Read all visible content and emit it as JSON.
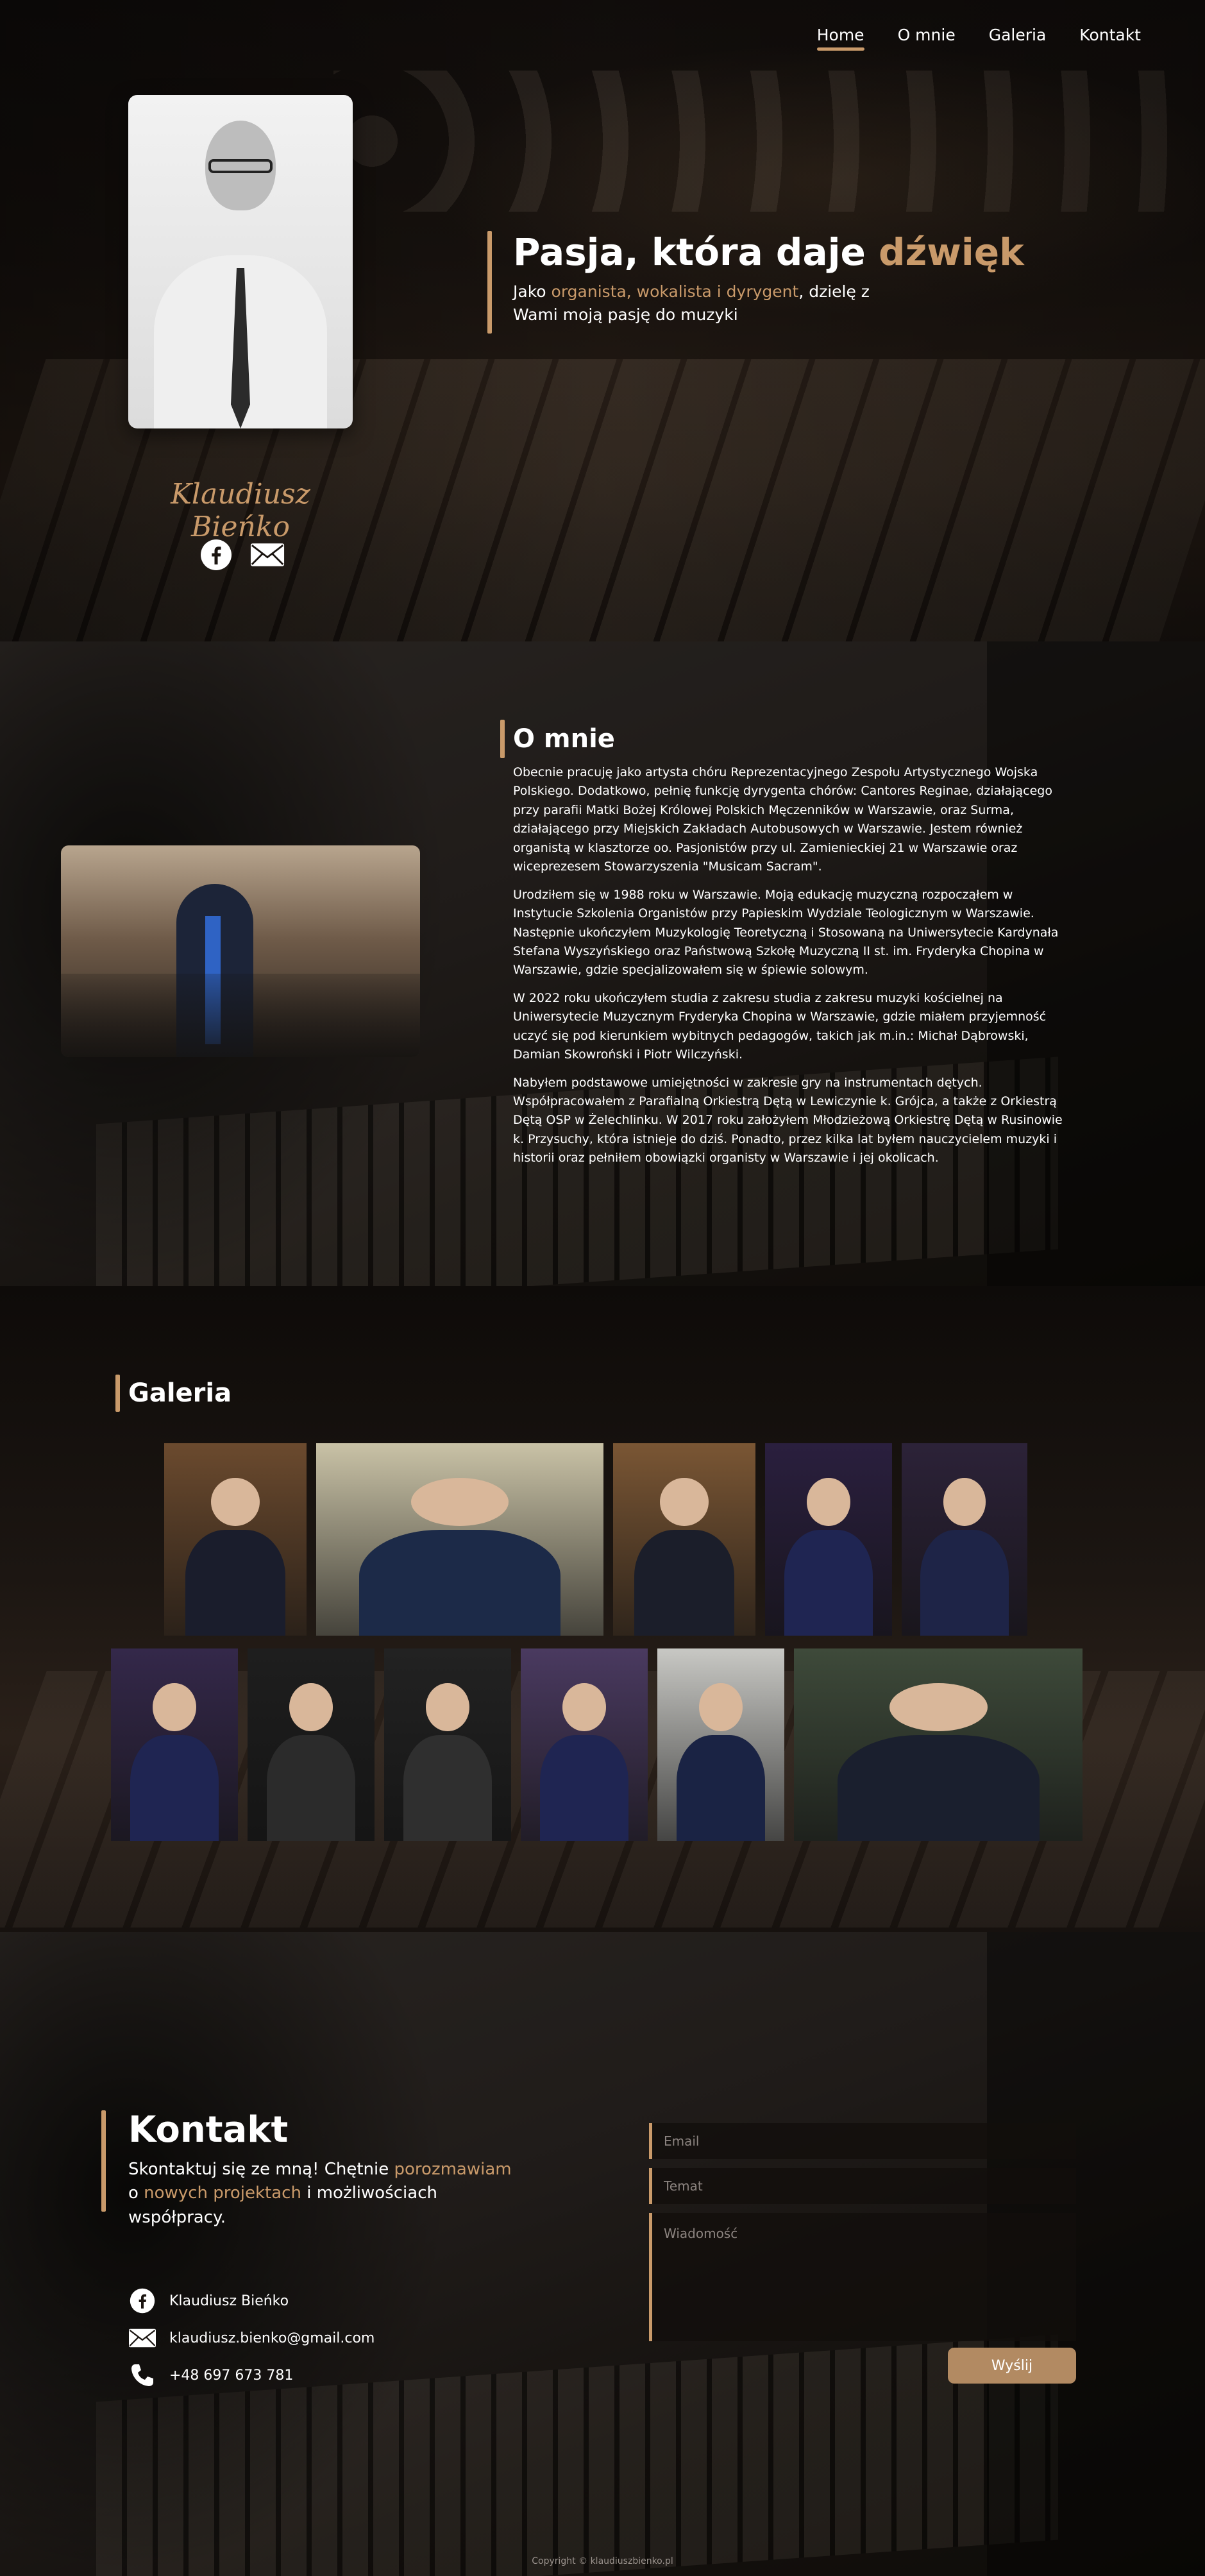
{
  "colors": {
    "accent": "#c99a6a",
    "button": "#b28a62",
    "background": "#0b0908"
  },
  "nav": {
    "items": [
      {
        "label": "Home",
        "active": true
      },
      {
        "label": "O mnie",
        "active": false
      },
      {
        "label": "Galeria",
        "active": false
      },
      {
        "label": "Kontakt",
        "active": false
      }
    ]
  },
  "hero": {
    "signature": "Klaudiusz Bieńko",
    "title_main": "Pasja, która daje ",
    "title_accent": "dźwięk",
    "sub_prefix": "Jako ",
    "sub_accent": "organista, wokalista i dyrygent",
    "sub_suffix": ", dzielę z Wami moją pasję do muzyki",
    "social_icons": [
      "facebook-icon",
      "email-icon"
    ]
  },
  "about": {
    "heading": "O mnie",
    "paragraphs": [
      "Obecnie pracuję jako artysta chóru Reprezentacyjnego Zespołu Artystycznego Wojska Polskiego. Dodatkowo, pełnię funkcję dyrygenta chórów: Cantores Reginae, działającego przy parafii Matki Bożej Królowej Polskich Męczenników w Warszawie, oraz Surma, działającego przy Miejskich Zakładach Autobusowych w Warszawie. Jestem również organistą w klasztorze oo. Pasjonistów przy ul. Zamienieckiej 21 w Warszawie oraz wiceprezesem Stowarzyszenia \"Musicam Sacram\".",
      "Urodziłem się w 1988 roku w Warszawie. Moją edukację muzyczną rozpocząłem w Instytucie Szkolenia Organistów przy Papieskim Wydziale Teologicznym w Warszawie. Następnie ukończyłem Muzykologię Teoretyczną i Stosowaną na Uniwersytecie Kardynała Stefana Wyszyńskiego oraz Państwową Szkołę Muzyczną II st. im. Fryderyka Chopina w Warszawie, gdzie specjalizowałem się w śpiewie solowym.",
      "W 2022 roku ukończyłem studia z zakresu studia z zakresu muzyki kościelnej na Uniwersytecie Muzycznym Fryderyka Chopina w Warszawie, gdzie miałem przyjemność uczyć się pod kierunkiem wybitnych pedagogów, takich jak m.in.: Michał Dąbrowski, Damian Skowroński i Piotr Wilczyński.",
      "Nabyłem podstawowe umiejętności w zakresie gry na instrumentach dętych. Współpracowałem z Parafialną Orkiestrą Dętą w Lewiczynie k. Grójca, a także z Orkiestrą Dętą OSP w Żelechlinku. W 2017 roku założyłem Młodzieżową Orkiestrę Dętą w Rusinowie k. Przysuchy, która istnieje do dziś. Ponadto, przez kilka lat byłem nauczycielem muzyki i historii oraz pełniłem obowiązki organisty w Warszawie i jej okolicach."
    ]
  },
  "gallery": {
    "heading": "Galeria",
    "row1": [
      {
        "name": "gallery-photo-organ-1",
        "bg": "#6b4a2e",
        "body": "#1a1d2c"
      },
      {
        "name": "gallery-photo-singing",
        "bg": "#c9c2a6",
        "body": "#1c2a48"
      },
      {
        "name": "gallery-photo-organ-2",
        "bg": "#7a5634",
        "body": "#1b1e2a"
      },
      {
        "name": "gallery-photo-portrait-1",
        "bg": "#2a1f3e",
        "body": "#1f2552"
      },
      {
        "name": "gallery-photo-portrait-2",
        "bg": "#2c2238",
        "body": "#1e2447"
      }
    ],
    "row2": [
      {
        "name": "gallery-photo-portrait-3",
        "bg": "#34284a",
        "body": "#1f2552"
      },
      {
        "name": "gallery-photo-bw-1",
        "bg": "#1e1e1e",
        "body": "#2b2b2b"
      },
      {
        "name": "gallery-photo-bw-2",
        "bg": "#222222",
        "body": "#2f2f2f"
      },
      {
        "name": "gallery-photo-portrait-4",
        "bg": "#4a3a60",
        "body": "#1f2552"
      },
      {
        "name": "gallery-photo-conducting-1",
        "bg": "#c8c8c4",
        "body": "#1a2344"
      },
      {
        "name": "gallery-photo-conducting-2",
        "bg": "#3e4a3a",
        "body": "#1a1f2e"
      }
    ]
  },
  "contact": {
    "title": "Kontakt",
    "sub_prefix": "Skontaktuj się ze mną! Chętnie ",
    "sub_accent1": "porozmawiam",
    "sub_mid": " o ",
    "sub_accent2": "nowych projektach",
    "sub_suffix": " i możliwościach współpracy.",
    "items": [
      {
        "icon": "facebook-icon",
        "text": "Klaudiusz Bieńko"
      },
      {
        "icon": "email-icon",
        "text": "klaudiusz.bienko@gmail.com"
      },
      {
        "icon": "phone-icon",
        "text": "+48 697 673 781"
      }
    ],
    "form": {
      "email_placeholder": "Email",
      "subject_placeholder": "Temat",
      "message_placeholder": "Wiadomość",
      "send_label": "Wyślij"
    }
  },
  "footer": {
    "copyright": "Copyright © klaudiuszbienko.pl"
  }
}
